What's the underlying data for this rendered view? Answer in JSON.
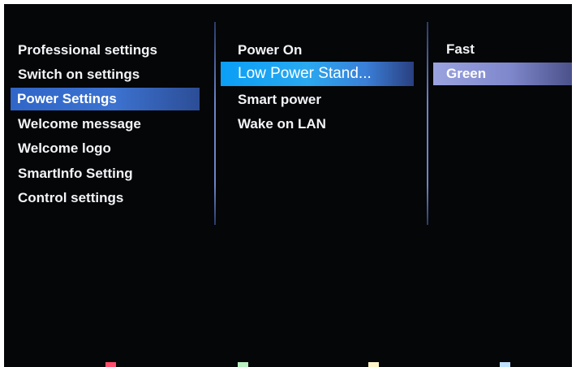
{
  "menu": {
    "col1": [
      "Professional settings",
      "Switch on settings",
      "Power Settings",
      "Welcome message",
      "Welcome logo",
      "SmartInfo Setting",
      "Control settings"
    ],
    "col1_selected": 2,
    "col2": [
      "Power On",
      "Low Power Stand...",
      "Smart power",
      "Wake on LAN"
    ],
    "col2_selected": 1,
    "col3": [
      "Fast",
      "Green"
    ],
    "col3_selected": 1
  },
  "color_keys": {
    "red": "#ff4c6a",
    "green": "#b8f0c0",
    "yellow": "#fff4c8",
    "blue": "#bfe0ff"
  }
}
